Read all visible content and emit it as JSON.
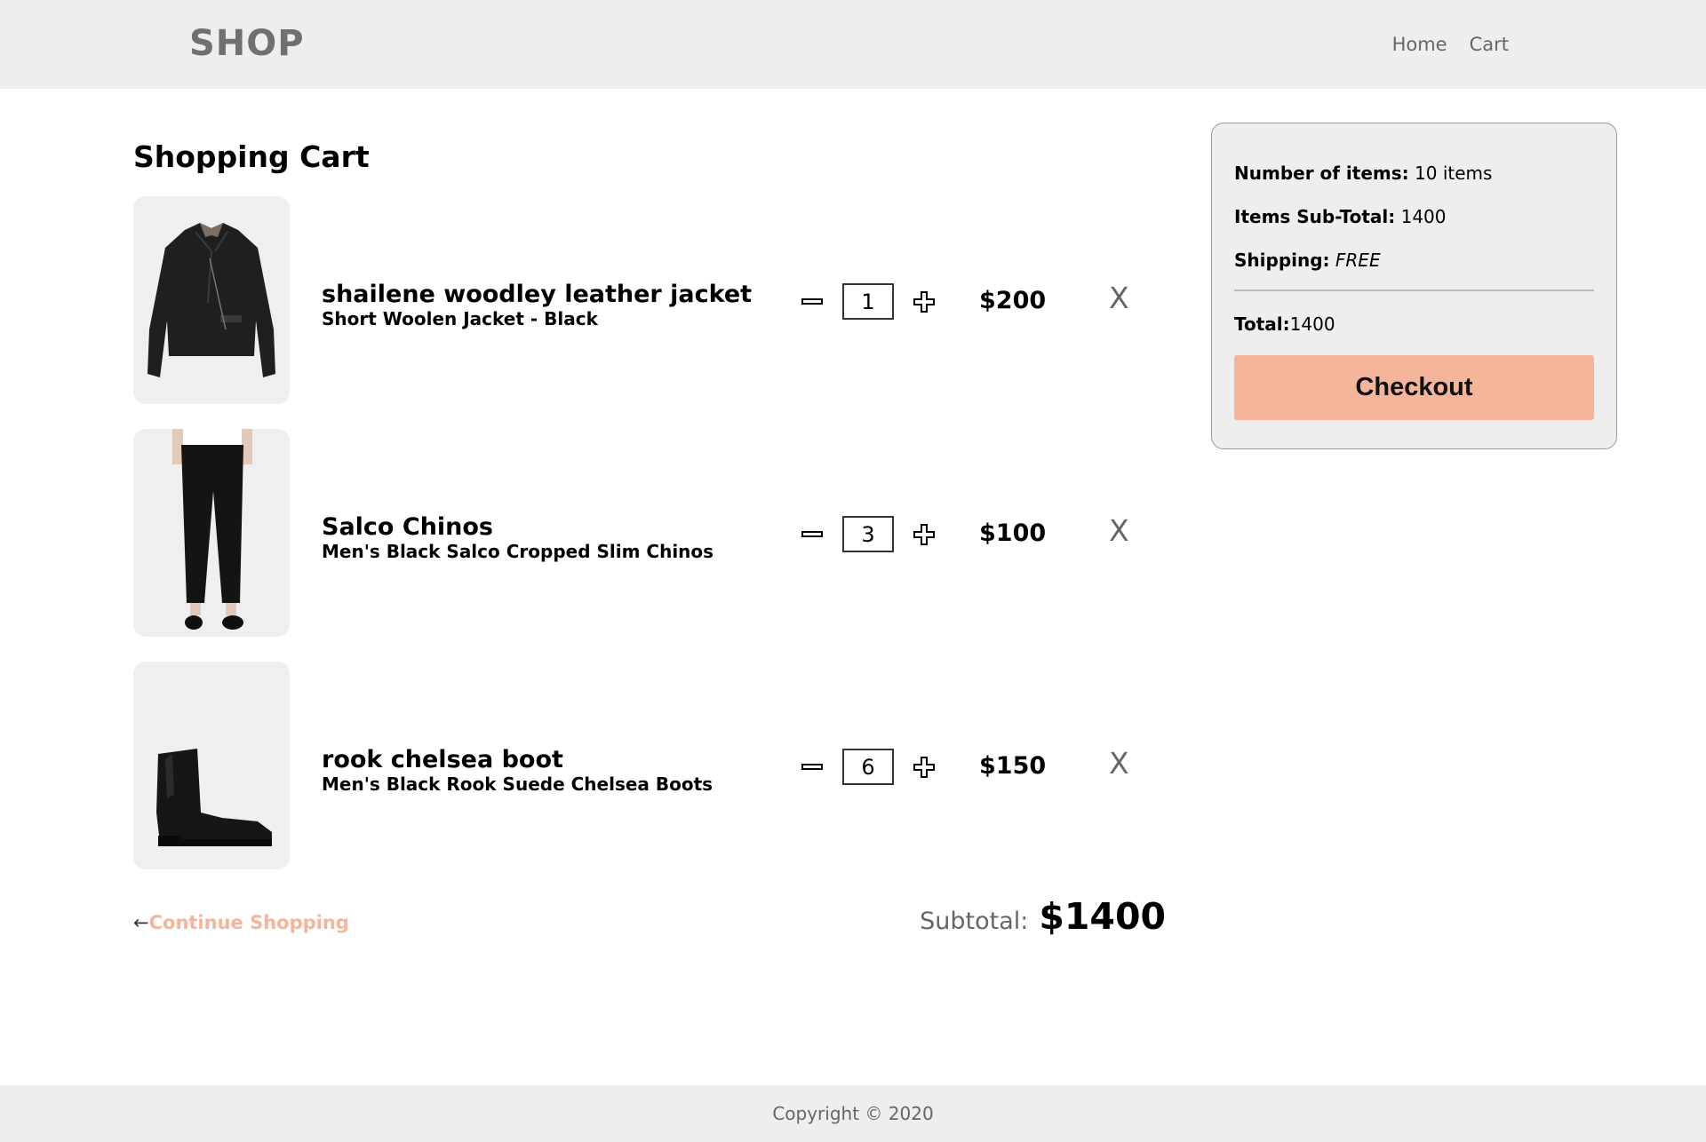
{
  "header": {
    "brand": "SHOP",
    "nav": [
      "Home",
      "Cart"
    ]
  },
  "cart": {
    "title": "Shopping Cart",
    "items": [
      {
        "name": "shailene woodley leather jacket",
        "description": "Short Woolen Jacket - Black",
        "quantity": "1",
        "price": "$200",
        "remove_label": "X",
        "image": "leather-jacket"
      },
      {
        "name": "Salco Chinos",
        "description": "Men's Black Salco Cropped Slim Chinos",
        "quantity": "3",
        "price": "$100",
        "remove_label": "X",
        "image": "black-chinos"
      },
      {
        "name": "rook chelsea boot",
        "description": "Men's Black Rook Suede Chelsea Boots",
        "quantity": "6",
        "price": "$150",
        "remove_label": "X",
        "image": "chelsea-boot"
      }
    ],
    "continue_arrow": "←",
    "continue_label": "Continue Shopping",
    "subtotal_label": "Subtotal:",
    "subtotal_value": "$1400"
  },
  "summary": {
    "items_label": "Number of items:",
    "items_value": " 10 items",
    "subtotal_label": "Items Sub-Total:",
    "subtotal_value": " 1400",
    "shipping_label": "Shipping:",
    "shipping_value": "FREE",
    "total_label": "Total:",
    "total_value": "1400",
    "checkout_label": "Checkout"
  },
  "footer": {
    "copyright": "Copyright © 2020"
  },
  "colors": {
    "accent": "#f4b59b",
    "header_bg": "#eeeeee",
    "muted_text": "#666666"
  },
  "icons": {
    "decrement": "minus-icon",
    "increment": "plus-icon",
    "remove": "close-icon"
  }
}
